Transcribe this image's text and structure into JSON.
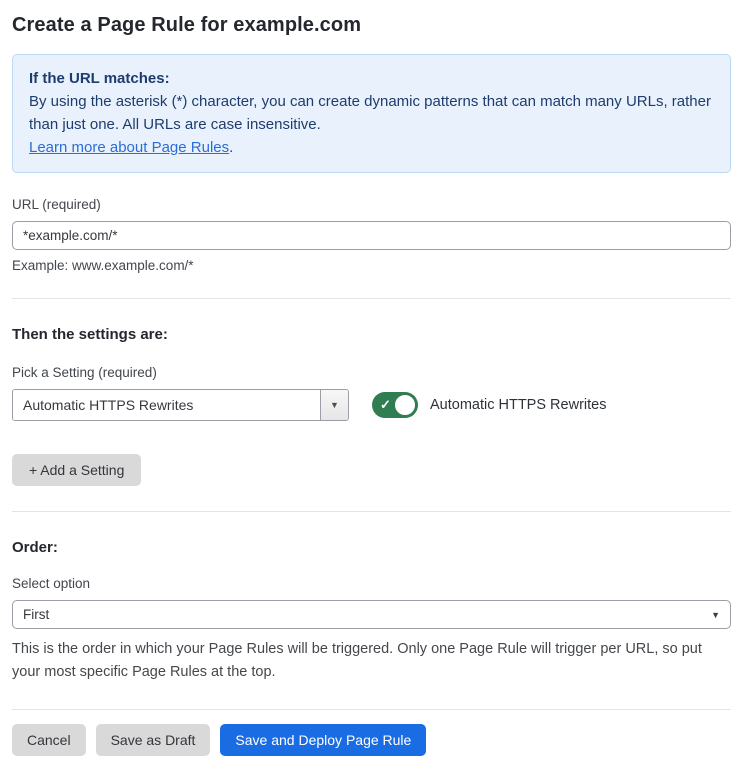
{
  "page": {
    "title": "Create a Page Rule for example.com"
  },
  "info_box": {
    "heading": "If the URL matches:",
    "body": "By using the asterisk (*) character, you can create dynamic patterns that can match many URLs, rather than just one. All URLs are case insensitive.",
    "link_label": "Learn more about Page Rules",
    "link_suffix": "."
  },
  "url_field": {
    "label": "URL (required)",
    "value": "*example.com/*",
    "hint": "Example: www.example.com/*"
  },
  "settings_section": {
    "heading": "Then the settings are:",
    "pick_label": "Pick a Setting (required)",
    "selected_setting": "Automatic HTTPS Rewrites",
    "toggle_label": "Automatic HTTPS Rewrites",
    "toggle_state": "on",
    "add_button_label": "+ Add a Setting"
  },
  "order_section": {
    "heading": "Order:",
    "select_label": "Select option",
    "selected_option": "First",
    "help_text": "This is the order in which your Page Rules will be triggered. Only one Page Rule will trigger per URL, so put your most specific Page Rules at the top."
  },
  "footer": {
    "cancel_label": "Cancel",
    "save_draft_label": "Save as Draft",
    "save_deploy_label": "Save and Deploy Page Rule"
  },
  "icons": {
    "combo_dropdown_arrow": "▼",
    "select_dropdown_arrow": "▼",
    "toggle_check": "✓"
  },
  "colors": {
    "info_bg": "#e9f2fc",
    "info_border": "#bcd8f7",
    "info_text": "#1e3c6e",
    "link": "#2c6cd6",
    "toggle_on_green": "#2f7d51",
    "primary_button_blue": "#1a6ce3",
    "secondary_button_gray": "#d9d9d9"
  }
}
